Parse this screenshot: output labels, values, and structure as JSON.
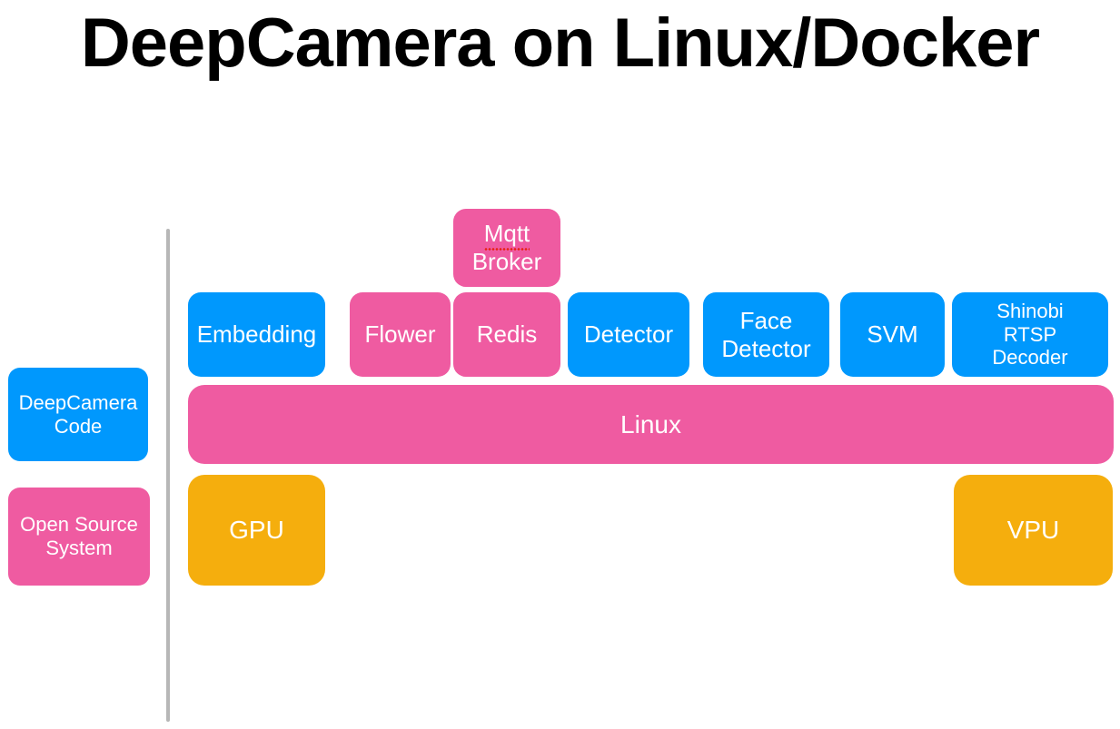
{
  "slide": {
    "title": "DeepCamera on Linux/Docker",
    "background_color": "#ffffff",
    "title_color": "#000000"
  },
  "colors": {
    "deepcamera_blue": "#0098fd",
    "open_source_pink": "#ef5ba1",
    "hardware_orange": "#f5ae0d",
    "divider_gray": "#b7b7b7",
    "label_white": "#ffffff",
    "spellcheck_red": "#e8200f"
  },
  "legend": {
    "items": [
      {
        "label": "DeepCamera\nCode",
        "color": "#0098fd",
        "meaning": "deepcamera-code"
      },
      {
        "label": "Open Source\nSystem",
        "color": "#ef5ba1",
        "meaning": "open-source-system"
      }
    ]
  },
  "diagram": {
    "broker_row": [
      {
        "label": "Mqtt\nBroker",
        "color": "#ef5ba1",
        "misspelled_word": "Mqtt"
      }
    ],
    "service_row": [
      {
        "label": "Embedding",
        "color": "#0098fd"
      },
      {
        "label": "Flower",
        "color": "#ef5ba1"
      },
      {
        "label": "Redis",
        "color": "#ef5ba1"
      },
      {
        "label": "Detector",
        "color": "#0098fd"
      },
      {
        "label": "Face\nDetector",
        "color": "#0098fd"
      },
      {
        "label": "SVM",
        "color": "#0098fd"
      },
      {
        "label": "Shinobi\nRTSP\nDecoder",
        "color": "#0098fd"
      }
    ],
    "os_row": [
      {
        "label": "Linux",
        "color": "#ef5ba1"
      }
    ],
    "hardware_row": [
      {
        "label": "GPU",
        "color": "#f5ae0d"
      },
      {
        "label": "VPU",
        "color": "#f5ae0d"
      }
    ]
  }
}
